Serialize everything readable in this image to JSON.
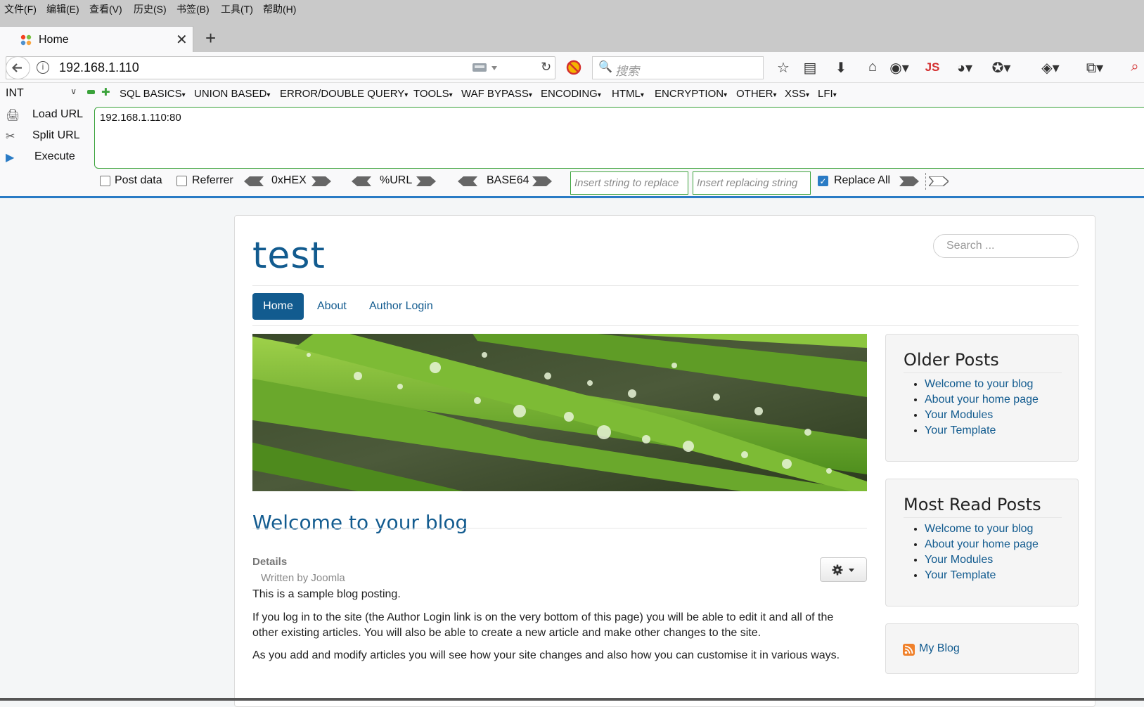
{
  "menubar": [
    "文件(F)",
    "编辑(E)",
    "查看(V)",
    "历史(S)",
    "书签(B)",
    "工具(T)",
    "帮助(H)"
  ],
  "tab": {
    "title": "Home"
  },
  "urlbar": {
    "url": "192.168.1.110"
  },
  "search": {
    "placeholder": "搜索"
  },
  "toolbar_icons": [
    "star-icon",
    "reading-list-icon",
    "download-icon",
    "home-icon",
    "globe-icon",
    "js-icon",
    "extension-icon",
    "palette-icon",
    "menu-icon",
    "layers-icon",
    "share-icon",
    "search-icon"
  ],
  "hackbar": {
    "select_value": "INT",
    "menus": [
      "SQL BASICS",
      "UNION BASED",
      "ERROR/DOUBLE QUERY",
      "TOOLS",
      "WAF BYPASS",
      "ENCODING",
      "HTML",
      "ENCRYPTION",
      "OTHER",
      "XSS",
      "LFI"
    ],
    "load_url": "Load URL",
    "split_url": "Split URL",
    "execute": "Execute",
    "textarea_value": "192.168.1.110:80",
    "post_data": "Post data",
    "referrer": "Referrer",
    "hex": "0xHEX",
    "url": "%URL",
    "base64": "BASE64",
    "replace_placeholder": "Insert string to replace",
    "replacing_placeholder": "Insert replacing string",
    "replace_all": "Replace All"
  },
  "site": {
    "title": "test",
    "search_placeholder": "Search ...",
    "nav": [
      "Home",
      "About",
      "Author Login"
    ]
  },
  "article": {
    "title": "Welcome to your blog",
    "details_label": "Details",
    "written_by": "Written by Joomla",
    "paragraphs": [
      "This is a sample blog posting.",
      "If you log in to the site (the Author Login link is on the very bottom of this page) you will be able to edit it and all of the other existing articles. You will also be able to create a new article and make other changes to the site.",
      "As you add and modify articles you will see how your site changes and also how you can customise it in various ways."
    ]
  },
  "modules": {
    "older": {
      "title": "Older Posts",
      "items": [
        "Welcome to your blog",
        "About your home page",
        "Your Modules",
        "Your Template"
      ]
    },
    "most_read": {
      "title": "Most Read Posts",
      "items": [
        "Welcome to your blog",
        "About your home page",
        "Your Modules",
        "Your Template"
      ]
    },
    "feed": {
      "label": "My Blog"
    }
  },
  "colors": {
    "link": "#125b8f",
    "accent": "#2a7bc5",
    "hackbar_border": "#3aa23a"
  }
}
